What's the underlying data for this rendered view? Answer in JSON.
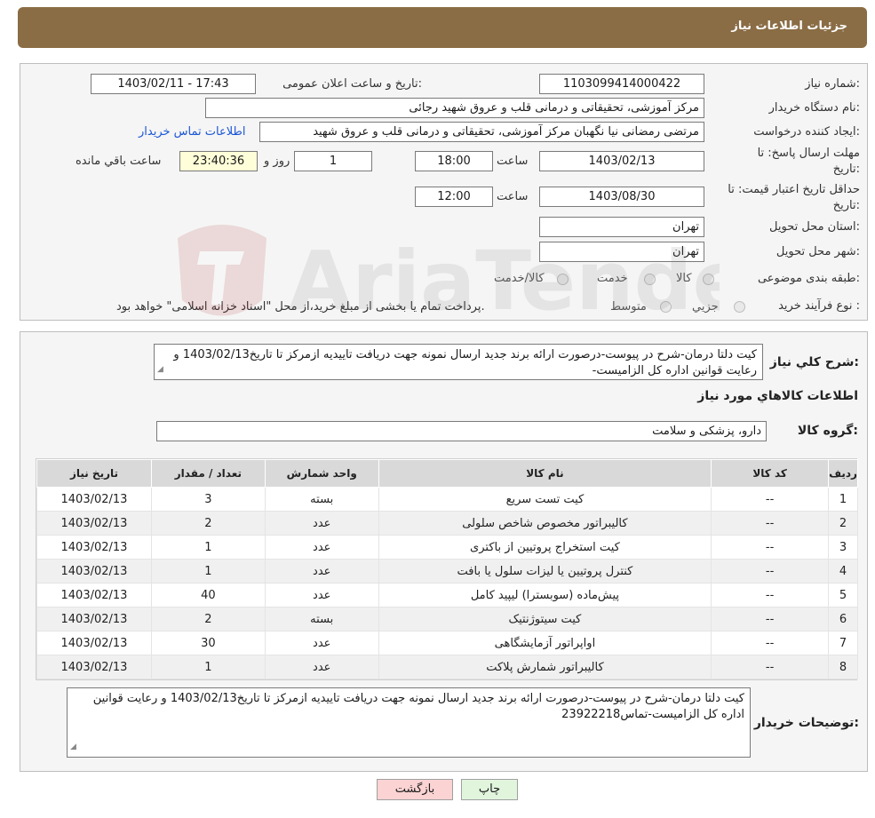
{
  "header": {
    "title": "جزئیات اطلاعات نیاز"
  },
  "form": {
    "need_number_label": "شماره نیاز:",
    "need_number": "1103099414000422",
    "announce_label": "تاریخ و ساعت اعلان عمومی:",
    "announce_value": "1403/02/11 - 17:43",
    "buyer_org_label": "نام دستگاه خریدار:",
    "buyer_org": "مرکز آموزشی، تحقیقاتی و درمانی قلب و عروق شهید رجائی",
    "creator_label": "ایجاد کننده درخواست:",
    "creator": "مرتضی رمضانی نیا نگهبان مرکز آموزشی، تحقیقاتی و درمانی قلب و عروق شهید",
    "contact_link": "اطلاعات تماس خریدار",
    "deadline_label_1": "مهلت ارسال پاسخ: تا",
    "deadline_label_2": "تاریخ:",
    "deadline_date": "1403/02/13",
    "time_word": "ساعت",
    "deadline_time": "18:00",
    "days_value": "1",
    "days_and": "روز و",
    "remaining_time": "23:40:36",
    "remaining_label": "ساعت باقي مانده",
    "validity_label_1": "حداقل تاریخ اعتبار قیمت: تا",
    "validity_label_2": "تاریخ:",
    "validity_date": "1403/08/30",
    "validity_time": "12:00",
    "province_label": "استان محل تحویل:",
    "province": "تهران",
    "city_label": "شهر محل تحویل:",
    "city": "تهران",
    "category_label": "طبقه بندی موضوعی:",
    "category_options": [
      "کالا",
      "خدمت",
      "کالا/خدمت"
    ],
    "process_label": "نوع فرآیند خرید :",
    "process_options": [
      "جزيي",
      "متوسط"
    ],
    "process_note": "پرداخت تمام یا بخشی از مبلغ خرید،از محل \"اسناد خزانه اسلامی\" خواهد بود."
  },
  "summary": {
    "label": "شرح کلي نياز:",
    "text": "کیت دلتا درمان-شرح در پیوست-درصورت ارائه برند جدید ارسال نمونه جهت دریافت تاییدیه ازمرکز تا تاریخ1403/02/13 و رعایت قوانین اداره کل الزامیست-"
  },
  "goods": {
    "section_title": "اطلاعات کالاهاي مورد نياز",
    "group_label": "گروه کالا:",
    "group_value": "دارو، پزشکی و سلامت",
    "columns": [
      "رديف",
      "کد کالا",
      "نام کالا",
      "واحد شمارش",
      "تعداد / مقدار",
      "تاريخ نياز"
    ],
    "rows": [
      [
        "1",
        "--",
        "کیت تست سریع",
        "بسته",
        "3",
        "1403/02/13"
      ],
      [
        "2",
        "--",
        "کالیبراتور مخصوص شاخص سلولی",
        "عدد",
        "2",
        "1403/02/13"
      ],
      [
        "3",
        "--",
        "کیت استخراج پروتیین از باکتری",
        "عدد",
        "1",
        "1403/02/13"
      ],
      [
        "4",
        "--",
        "کنترل پروتیین یا لیزات سلول یا بافت",
        "عدد",
        "1",
        "1403/02/13"
      ],
      [
        "5",
        "--",
        "پیش‌ماده (سوبسترا) لیپید کامل",
        "عدد",
        "40",
        "1403/02/13"
      ],
      [
        "6",
        "--",
        "کیت سیتوژنتیک",
        "بسته",
        "2",
        "1403/02/13"
      ],
      [
        "7",
        "--",
        "اواپراتور آزمایشگاهی",
        "عدد",
        "30",
        "1403/02/13"
      ],
      [
        "8",
        "--",
        "کالیبراتور شمارش پلاکت",
        "عدد",
        "1",
        "1403/02/13"
      ]
    ]
  },
  "buyer_notes": {
    "label": "توضیحات خریدار:",
    "text": "کیت دلتا درمان-شرح در پیوست-درصورت ارائه برند جدید ارسال نمونه جهت دریافت تاییدیه ازمرکز تا تاریخ1403/02/13 و رعایت قوانین اداره کل الزامیست-تماس23922218"
  },
  "buttons": {
    "print": "چاپ",
    "back": "بازگشت"
  },
  "colors": {
    "header_bg": "#8a6d45",
    "link": "#1a55d6",
    "back_button": "#fbd3d3",
    "print_button": "#e1f5dd",
    "timer_box": "#fefed8"
  }
}
